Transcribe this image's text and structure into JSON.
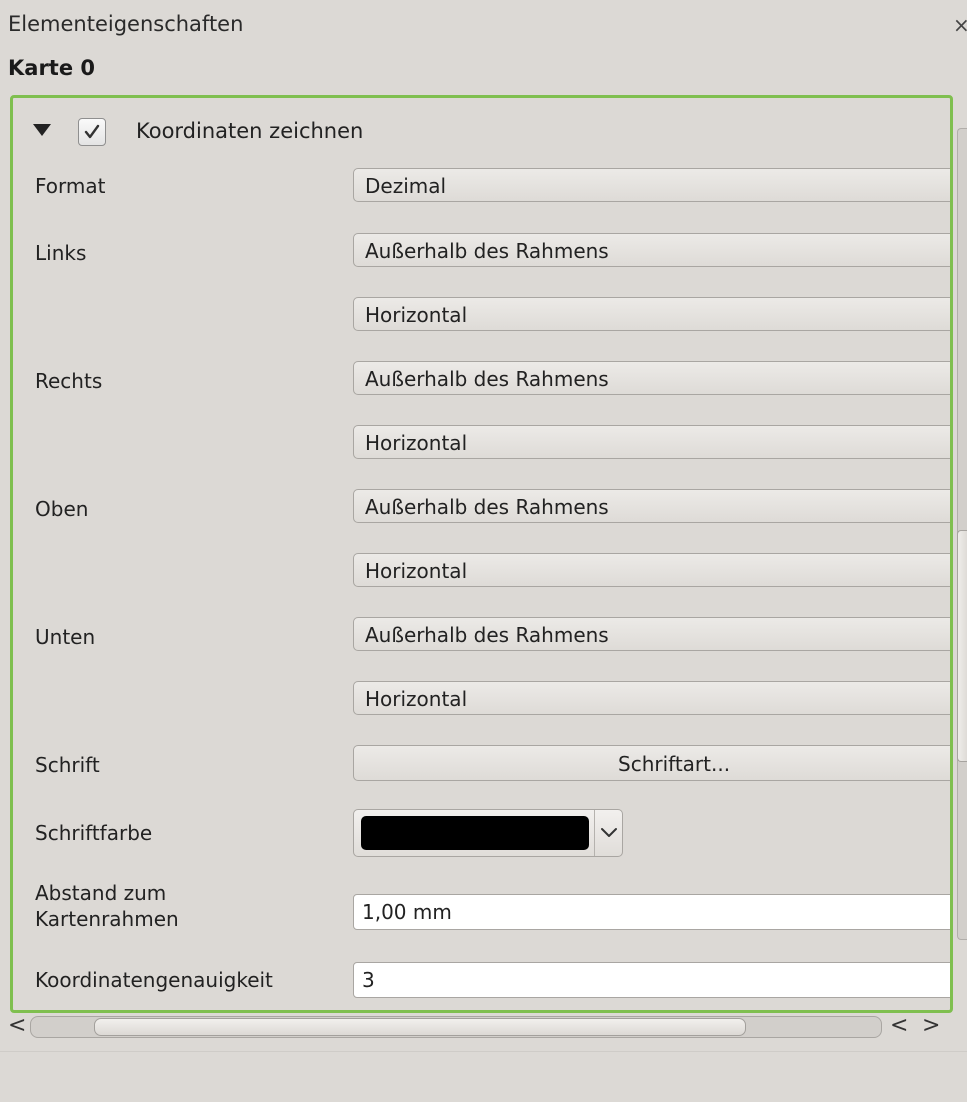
{
  "window": {
    "title": "Elementeigenschaften",
    "close_glyph": "×",
    "subtitle": "Karte 0"
  },
  "group": {
    "label": "Koordinaten zeichnen",
    "checked": true
  },
  "rows": {
    "format_label": "Format",
    "format_value": "Dezimal",
    "links_label": "Links",
    "links_position": "Außerhalb des Rahmens",
    "links_direction": "Horizontal",
    "rechts_label": "Rechts",
    "rechts_position": "Außerhalb des Rahmens",
    "rechts_direction": "Horizontal",
    "oben_label": "Oben",
    "oben_position": "Außerhalb des Rahmens",
    "oben_direction": "Horizontal",
    "unten_label": "Unten",
    "unten_position": "Außerhalb des Rahmens",
    "unten_direction": "Horizontal",
    "schrift_label": "Schrift",
    "schrift_button": "Schriftart...",
    "schriftfarbe_label": "Schriftfarbe",
    "schriftfarbe_color": "#000000",
    "abstand_label_line1": "Abstand zum",
    "abstand_label_line2": "Kartenrahmen",
    "abstand_value": "1,00 mm",
    "genauigkeit_label": "Koordinatengenauigkeit",
    "genauigkeit_value": "3"
  },
  "scrollbar": {
    "left_glyph": "<",
    "prev_glyph": "<",
    "next_glyph": ">"
  },
  "colors": {
    "panel_border": "#7fbf4f",
    "background": "#dcd9d5"
  }
}
